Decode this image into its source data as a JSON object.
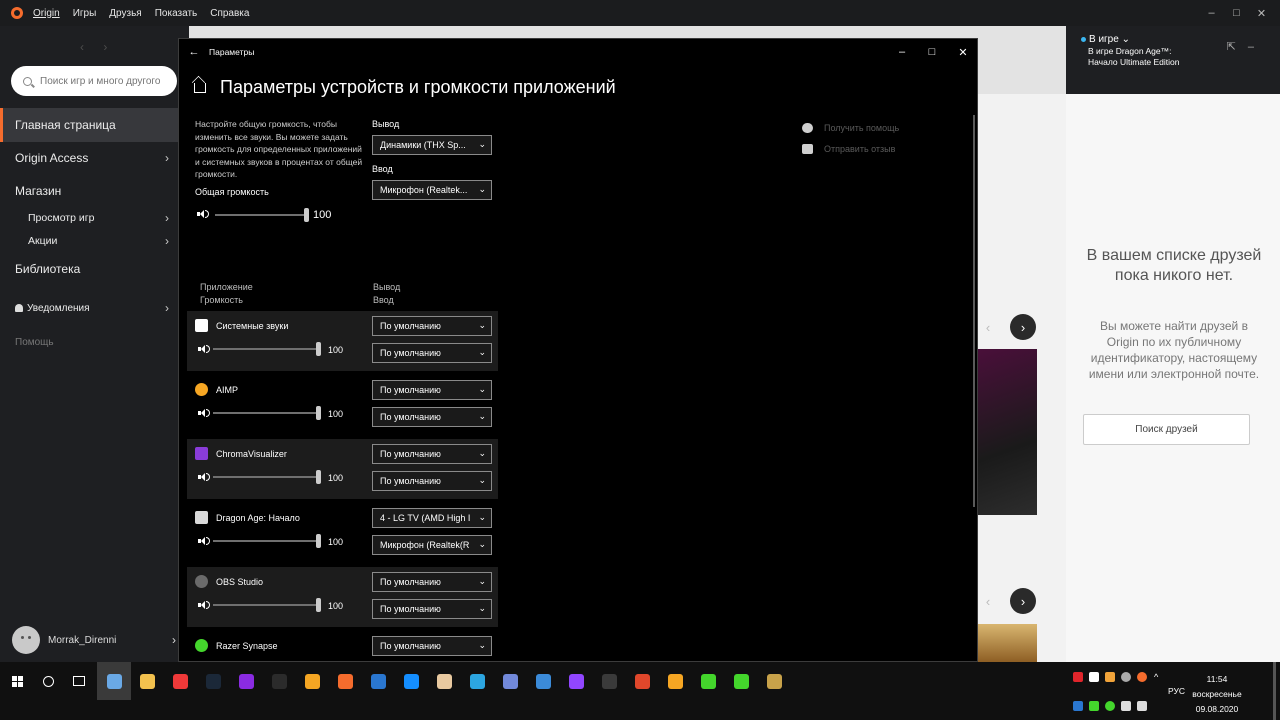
{
  "origin": {
    "menu": [
      "Origin",
      "Игры",
      "Друзья",
      "Показать",
      "Справка"
    ],
    "search_placeholder": "Поиск игр и много другого",
    "nav": {
      "home": "Главная страница",
      "access": "Origin Access",
      "store": "Магазин",
      "browse": "Просмотр игр",
      "deals": "Акции",
      "library": "Библиотека",
      "notifications": "Уведомления",
      "help": "Помощь"
    },
    "username": "Morrak_Direnni"
  },
  "friends": {
    "status": "В игре",
    "game": "В игре Dragon Age™: Начало Ultimate Edition",
    "empty_title": "В вашем списке друзей пока никого нет.",
    "empty_hint": "Вы можете найти друзей в Origin по их публичному идентификатору, настоящему имени или электронной почте.",
    "find_button": "Поиск друзей"
  },
  "settings": {
    "window_title": "Параметры",
    "page_title": "Параметры устройств и громкости приложений",
    "description": "Настройте общую громкость, чтобы изменить все звуки. Вы можете задать громкость для определенных приложений и системных звуков в процентах от общей громкости.",
    "master_label": "Общая громкость",
    "master_volume": "100",
    "master_level": 100,
    "output_label": "Вывод",
    "output_device": "Динамики (THX Sp...",
    "input_label": "Ввод",
    "input_device": "Микрофон (Realtek...",
    "col_app": "Приложение",
    "col_volume": "Громкость",
    "col_output": "Вывод",
    "col_input": "Ввод",
    "help": "Получить помощь",
    "feedback": "Отправить отзыв",
    "apps": [
      {
        "name": "Системные звуки",
        "volume": "100",
        "level": 100,
        "output": "По умолчанию",
        "input": "По умолчанию",
        "icon": "system-sounds-icon"
      },
      {
        "name": "AIMP",
        "volume": "100",
        "level": 100,
        "output": "По умолчанию",
        "input": "По умолчанию",
        "icon": "aimp-icon"
      },
      {
        "name": "ChromaVisualizer",
        "volume": "100",
        "level": 100,
        "output": "По умолчанию",
        "input": "По умолчанию",
        "icon": "chroma-visualizer-icon"
      },
      {
        "name": "Dragon Age: Начало",
        "volume": "100",
        "level": 100,
        "output": "4 - LG TV (AMD High I",
        "input": "Микрофон (Realtek(R",
        "icon": "dragon-age-icon"
      },
      {
        "name": "OBS Studio",
        "volume": "100",
        "level": 100,
        "output": "По умолчанию",
        "input": "По умолчанию",
        "icon": "obs-studio-icon"
      },
      {
        "name": "Razer Synapse",
        "volume": "",
        "level": null,
        "output": "По умолчанию",
        "input": "",
        "icon": "razer-synapse-icon"
      }
    ]
  },
  "taskbar": {
    "lang": "РУС",
    "time": "11:54",
    "day": "воскресенье",
    "date": "09.08.2020",
    "apps": [
      {
        "icon": "settings-gear-icon",
        "color": "#6aa9e6"
      },
      {
        "icon": "file-explorer-icon",
        "color": "#f2c14e"
      },
      {
        "icon": "vivaldi-icon",
        "color": "#ef3939"
      },
      {
        "icon": "steam-icon",
        "color": "#1b2838"
      },
      {
        "icon": "ring-app-icon",
        "color": "#8a2be2"
      },
      {
        "icon": "epic-games-icon",
        "color": "#2b2b2b"
      },
      {
        "icon": "rockstar-icon",
        "color": "#f5a623"
      },
      {
        "icon": "origin-icon",
        "color": "#f56c2d"
      },
      {
        "icon": "uplay-icon",
        "color": "#2a77d0"
      },
      {
        "icon": "battle-net-icon",
        "color": "#148eff"
      },
      {
        "icon": "gog-icon",
        "color": "#e8c9a0"
      },
      {
        "icon": "telegram-icon",
        "color": "#2ca5e0"
      },
      {
        "icon": "discord-icon",
        "color": "#7289da"
      },
      {
        "icon": "game-controller-icon",
        "color": "#3b8bd9"
      },
      {
        "icon": "twitch-icon",
        "color": "#9146ff"
      },
      {
        "icon": "obs-icon",
        "color": "#3a3a3a"
      },
      {
        "icon": "red-circle-icon",
        "color": "#e0472b"
      },
      {
        "icon": "aimp-icon",
        "color": "#f6a623"
      },
      {
        "icon": "razer-cortex-icon",
        "color": "#44d62c"
      },
      {
        "icon": "razer-synapse-icon",
        "color": "#44d62c"
      },
      {
        "icon": "dragon-age-icon",
        "color": "#c8a24a"
      }
    ]
  }
}
